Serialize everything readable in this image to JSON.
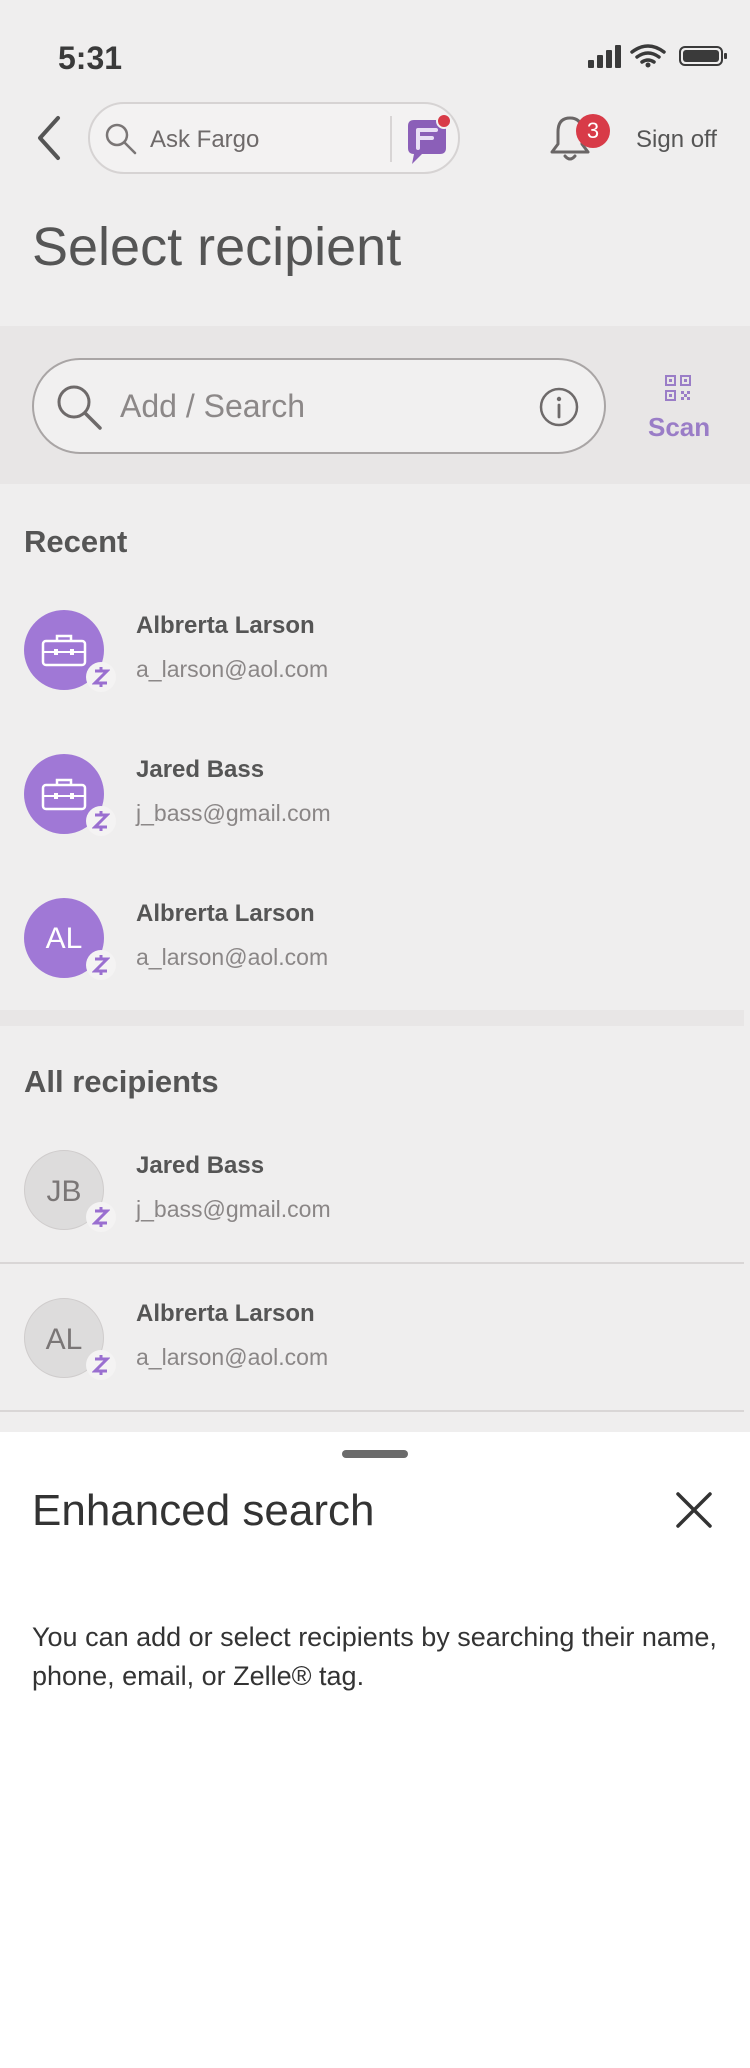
{
  "status_bar": {
    "time": "5:31"
  },
  "header": {
    "fargo_placeholder": "Ask Fargo",
    "notification_count": "3",
    "sign_off": "Sign off"
  },
  "page": {
    "title": "Select recipient"
  },
  "search": {
    "placeholder": "Add / Search",
    "scan_label": "Scan"
  },
  "recent": {
    "title": "Recent",
    "items": [
      {
        "name": "Albrerta Larson",
        "email": "a_larson@aol.com",
        "avatar": "briefcase-icon"
      },
      {
        "name": "Jared Bass",
        "email": "j_bass@gmail.com",
        "avatar": "briefcase-icon"
      },
      {
        "name": "Albrerta Larson",
        "email": "a_larson@aol.com",
        "initials": "AL"
      }
    ]
  },
  "all_recipients": {
    "title": "All recipients",
    "items": [
      {
        "name": "Jared Bass",
        "email": "j_bass@gmail.com",
        "initials": "JB"
      },
      {
        "name": "Albrerta Larson",
        "email": "a_larson@aol.com",
        "initials": "AL"
      }
    ]
  },
  "sheet": {
    "title": "Enhanced search",
    "text": "You can add or select recipients by searching their name, phone, email, or Zelle® tag."
  },
  "colors": {
    "accent_purple": "#a078d6",
    "badge_red": "#d83b48",
    "background": "#efeeee"
  }
}
